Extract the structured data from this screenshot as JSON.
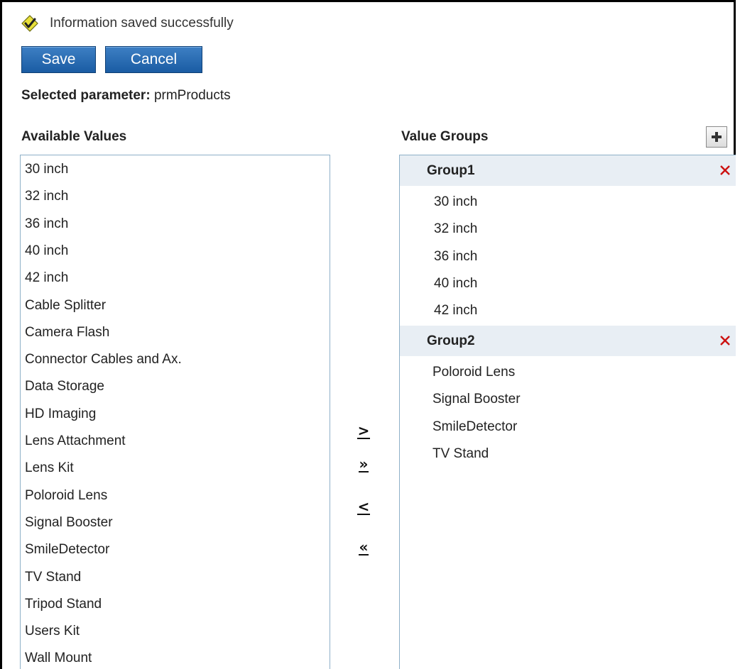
{
  "status": {
    "message": "Information saved successfully",
    "icon": "checkmark-icon"
  },
  "toolbar": {
    "save_label": "Save",
    "cancel_label": "Cancel"
  },
  "parameter": {
    "label": "Selected parameter:",
    "value": "prmProducts"
  },
  "available": {
    "header": "Available Values",
    "items": [
      "30 inch",
      "32 inch",
      "36 inch",
      "40 inch",
      "42 inch",
      "Cable Splitter",
      "Camera Flash",
      "Connector Cables and Ax.",
      "Data Storage",
      "HD Imaging",
      "Lens Attachment",
      "Lens Kit",
      "Poloroid Lens",
      "Signal Booster",
      "SmileDetector",
      "TV Stand",
      "Tripod Stand",
      "Users Kit",
      "Wall Mount"
    ]
  },
  "groups": {
    "header": "Value Groups",
    "add_icon": "plus-icon",
    "list": [
      {
        "name": "Group1",
        "items": [
          "30 inch",
          "32 inch",
          "36 inch",
          "40 inch",
          "42 inch"
        ]
      },
      {
        "name": "Group2",
        "items": [
          "Poloroid Lens",
          "Signal Booster",
          "SmileDetector",
          "TV Stand"
        ]
      }
    ]
  },
  "move_buttons": {
    "add_one": ">",
    "add_all": "»",
    "remove_one": "<",
    "remove_all": "«"
  },
  "colors": {
    "button_blue": "#2a6db5",
    "delete_red": "#cc1111",
    "group_header_bg": "#e8eef4"
  }
}
